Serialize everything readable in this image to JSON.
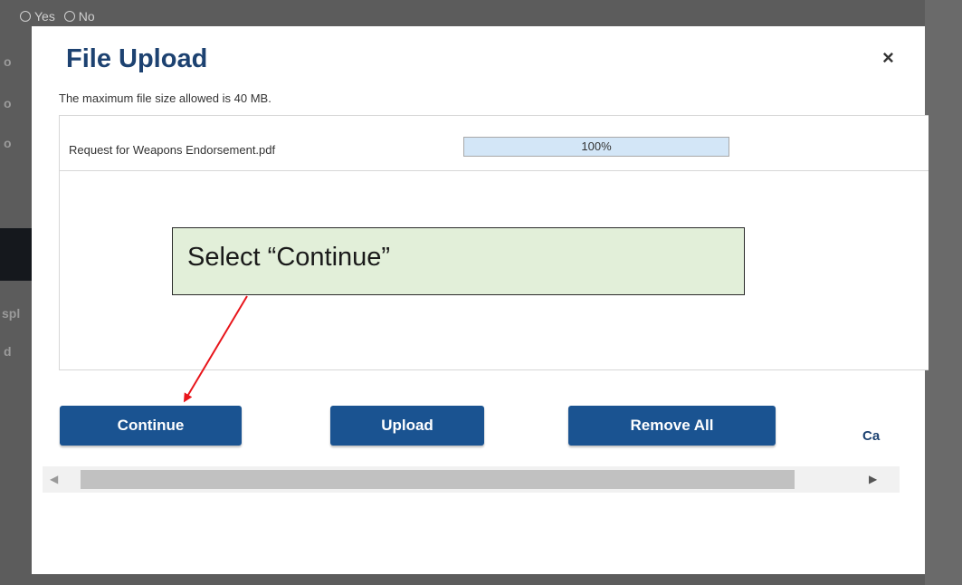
{
  "background": {
    "radio_row": {
      "yes_label": "Yes",
      "no_label": "No"
    },
    "left_glyphs": [
      "o",
      "o",
      "o",
      "spl",
      "d"
    ]
  },
  "modal": {
    "title": "File Upload",
    "close_label": "×",
    "max_size_text": "The maximum file size allowed is 40 MB.",
    "files": [
      {
        "name": "Request for Weapons Endorsement.pdf",
        "progress": 100,
        "progress_text": "100%"
      }
    ],
    "buttons": {
      "continue": "Continue",
      "upload": "Upload",
      "remove_all": "Remove All",
      "cancel": "Ca"
    },
    "scroll_arrows": {
      "left": "◀",
      "right": "▶"
    }
  },
  "annotation": {
    "callout_text": "Select “Continue”",
    "arrow_color": "#e8151b",
    "callout_bg": "#e2efd9"
  },
  "colors": {
    "primary_button": "#1a5391",
    "title": "#1d4271",
    "progress_fill": "#d3e6f7"
  }
}
